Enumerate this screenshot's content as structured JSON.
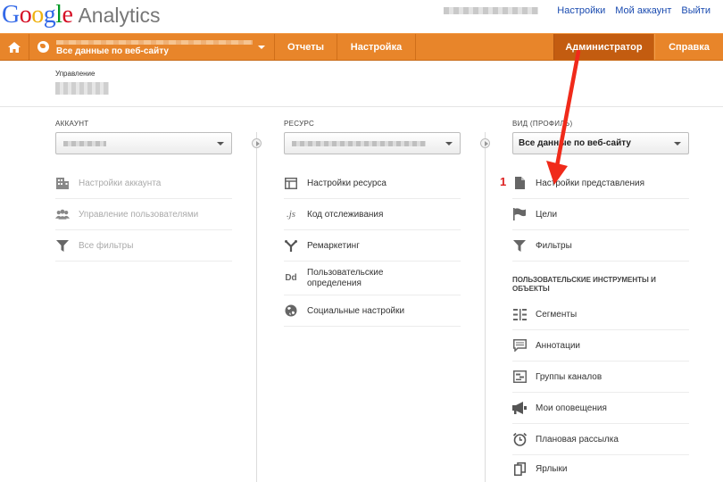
{
  "header": {
    "logo_google": "Google",
    "logo_product": "Analytics",
    "links": [
      "Настройки",
      "Мой аккаунт",
      "Выйти"
    ]
  },
  "nav": {
    "account_label": "Все данные по веб-сайту",
    "tabs": [
      "Отчеты",
      "Настройка"
    ],
    "admin": "Администратор",
    "help": "Справка",
    "accent": "#e8852a",
    "active_bg": "#c35c10"
  },
  "management": {
    "label": "Управление"
  },
  "account_col": {
    "title": "АККАУНТ",
    "items": [
      "Настройки аккаунта",
      "Управление пользователями",
      "Все фильтры"
    ]
  },
  "property_col": {
    "title": "РЕСУРС",
    "items": [
      "Настройки ресурса",
      "Код отслеживания",
      "Ремаркетинг",
      "Пользовательские определения",
      "Социальные настройки"
    ]
  },
  "view_col": {
    "title": "ВИД (ПРОФИЛЬ)",
    "selected": "Все данные по веб-сайту",
    "items": [
      "Настройки представления",
      "Цели",
      "Фильтры"
    ],
    "tools_heading": "ПОЛЬЗОВАТЕЛЬСКИЕ ИНСТРУМЕНТЫ И ОБЪЕКТЫ",
    "tools": [
      "Сегменты",
      "Аннотации",
      "Группы каналов",
      "Мои оповещения",
      "Плановая рассылка",
      "Ярлыки"
    ]
  },
  "annotation": {
    "badge": "1",
    "arrow_color": "#f02a1a"
  }
}
